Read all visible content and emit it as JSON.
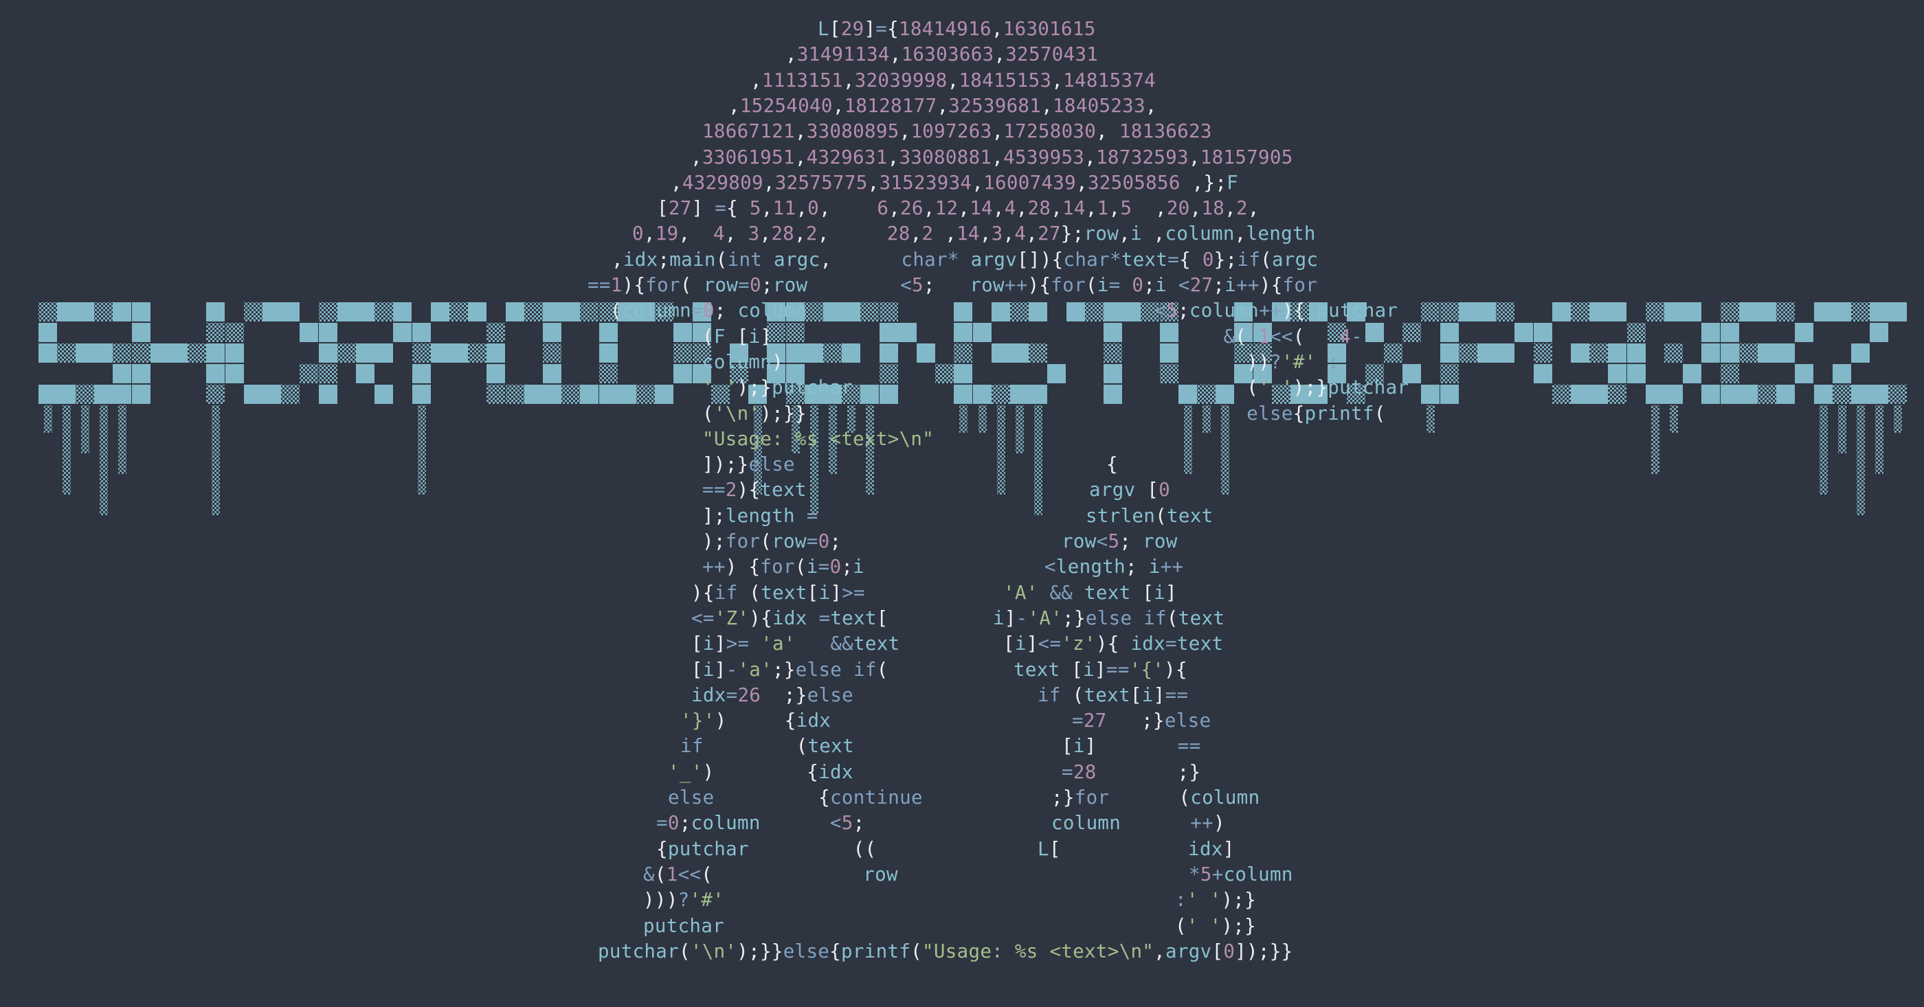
{
  "colors": {
    "background": "#2e3440",
    "banner_solid": "#88c0d0",
    "banner_dither": "#88c0d0",
    "number": "#b48ead",
    "keyword": "#81a1c1",
    "identifier": "#d8dee9",
    "function": "#88c0d0",
    "string": "#a3be8c",
    "punctuation": "#eceff4"
  },
  "banner": {
    "icon": "pixel-block-letters-banner"
  },
  "code_lines": [
    "L[29]={18414916,16301615",
    ",31491134,16303663,32570431",
    ",1113151,32039998,18415153,14815374",
    ",15254040,18128177,32539681,18405233,",
    "18667121,33080895,1097263,17258030, 18136623",
    ",33061951,4329631,33080881,4539953,18732593,18157905",
    ",4329809,32575775,31523934,16007439,32505856 ,};F",
    "[27] ={ 5,11,0,    6,26,12,14,4,28,14,1,5  ,20,18,2,",
    "0,19,  4, 3,28,2,     28,2 ,14,3,4,27};row,i ,column,length",
    ",idx;main(int argc,      char* argv[]){char*text={ 0};if(argc",
    "==1){for( row=0;row        <5;   row++){for(i= 0;i <27;i++){for",
    "(column=0; column                              <5;column++){ putchar",
    "(F [i]                                       &( 1<<(   4-",
    "column)                                        ))?'#' :",
    "' ');}putchar                                  (' ');}putchar",
    "('\\n');}}                                      else{printf(",
    "\"Usage: %s <text>\\n\"",
    "]);}else",
    "==2){text",
    "];length =",
    ");for(row=0;",
    "++) {for(i=0;i",
    "){if (text[i]>=",
    "<='Z'){idx =text[",
    "[i]>= 'a'   &&text",
    "[i]-'a';}else if(",
    "idx=26  ;}else",
    "'}')     {idx",
    "if        (text",
    "'_')        {idx",
    "else         {continue",
    "=0;column      <5;",
    "{putchar         ((",
    "&(1<<(             row",
    ")))?'#'",
    "putchar",
    "putchar('\\n');}}else{printf(\"Usage: %s <text>\\n\",argv[0]);}}"
  ],
  "code_lines_right": [
    "",
    "",
    "",
    "",
    "",
    "",
    "",
    "",
    "",
    "",
    "",
    "",
    "",
    "",
    "",
    "",
    "",
    "{",
    "argv [0",
    "strlen(text",
    "row<5; row",
    "<length; i++",
    "'A' && text [i]",
    "i]-'A';}else if(text",
    "[i]<='z'){ idx=text",
    "text [i]=='{'){",
    "if (text[i]==",
    "=27   ;}else",
    "[i]       ==",
    "=28       ;}",
    ";}for      (column",
    "column      ++)",
    "L[           idx]",
    "*5+column",
    ":' ');}",
    "(' ');}",
    ""
  ]
}
